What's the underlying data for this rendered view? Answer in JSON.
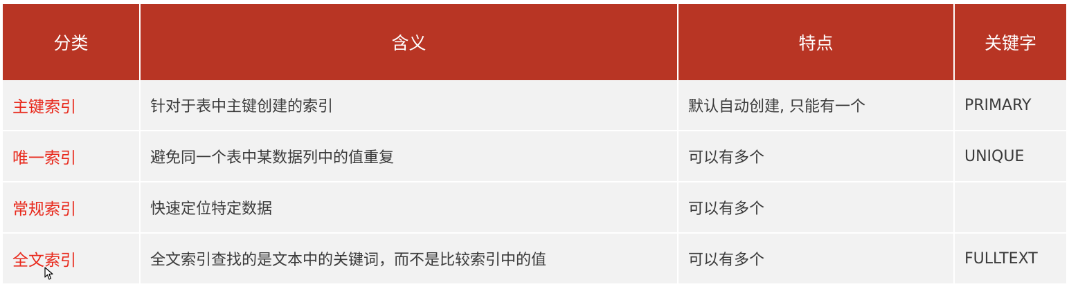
{
  "table": {
    "headers": [
      "分类",
      "含义",
      "特点",
      "关键字"
    ],
    "rows": [
      {
        "category": "主键索引",
        "meaning": "针对于表中主键创建的索引",
        "feature": "默认自动创建, 只能有一个",
        "keyword": "PRIMARY"
      },
      {
        "category": "唯一索引",
        "meaning": "避免同一个表中某数据列中的值重复",
        "feature": "可以有多个",
        "keyword": "UNIQUE"
      },
      {
        "category": "常规索引",
        "meaning": "快速定位特定数据",
        "feature": "可以有多个",
        "keyword": ""
      },
      {
        "category": "全文索引",
        "meaning": "全文索引查找的是文本中的关键词，而不是比较索引中的值",
        "feature": "可以有多个",
        "keyword": "FULLTEXT"
      }
    ]
  },
  "colors": {
    "header_bg": "#b83524",
    "header_text": "#ffffff",
    "category_text": "#e8291c",
    "cell_bg": "#f2f2f2",
    "body_text": "#3a3a3a"
  },
  "cursor": {
    "icon": "mouse-pointer-icon"
  }
}
